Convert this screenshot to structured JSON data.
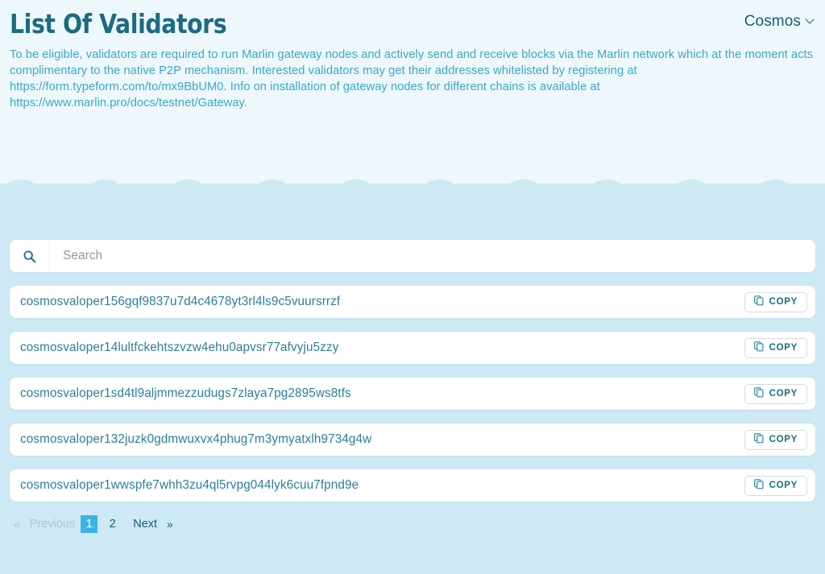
{
  "header": {
    "title": "List Of Validators",
    "chain_selector": {
      "label": "Cosmos",
      "icon": "chevron-down-icon"
    },
    "description": "To be eligible, validators are required to run Marlin gateway nodes and actively send and receive blocks via the Marlin network which at the moment acts complimentary to the native P2P mechanism. Interested validators may get their addresses whitelisted by registering at https://form.typeform.com/to/mx9BbUM0. Info on installation of gateway nodes for different chains is available at https://www.marlin.pro/docs/testnet/Gateway."
  },
  "search": {
    "placeholder": "Search",
    "value": "",
    "icon": "search-icon"
  },
  "validators": [
    {
      "address": "cosmosvaloper156gqf9837u7d4c4678yt3rl4ls9c5vuursrrzf",
      "copy_label": "COPY",
      "copy_icon": "copy-icon"
    },
    {
      "address": "cosmosvaloper14lultfckehtszvzw4ehu0apvsr77afvyju5zzy",
      "copy_label": "COPY",
      "copy_icon": "copy-icon"
    },
    {
      "address": "cosmosvaloper1sd4tl9aljmmezzudugs7zlaya7pg2895ws8tfs",
      "copy_label": "COPY",
      "copy_icon": "copy-icon"
    },
    {
      "address": "cosmosvaloper132juzk0gdmwuxvx4phug7m3ymyatxlh9734g4w",
      "copy_label": "COPY",
      "copy_icon": "copy-icon"
    },
    {
      "address": "cosmosvaloper1wwspfe7whh3zu4ql5rvpg044lyk6cuu7fpnd9e",
      "copy_label": "COPY",
      "copy_icon": "copy-icon"
    }
  ],
  "pagination": {
    "first_chevron": "«",
    "previous_label": "Previous",
    "pages": [
      "1",
      "2"
    ],
    "active_page": "1",
    "next_label": "Next",
    "last_chevron": "»"
  },
  "colors": {
    "hero_background": "#eef8fc",
    "page_background": "#cce9f4",
    "title": "#1c6b82",
    "description": "#3ba8c9",
    "address": "#2b7f9c",
    "accent": "#3bb5e6",
    "card": "#ffffff"
  }
}
